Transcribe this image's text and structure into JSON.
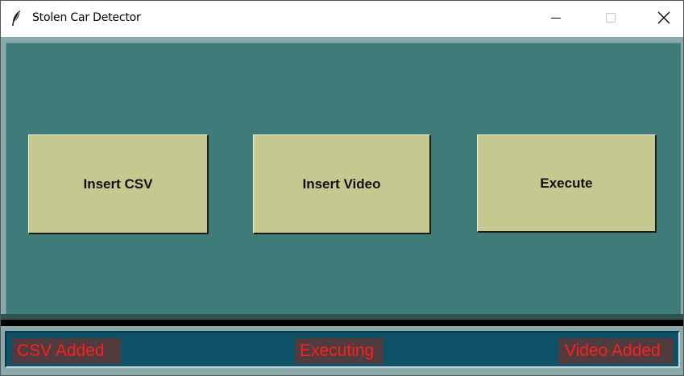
{
  "window": {
    "title": "Stolen Car Detector",
    "icon": "feather-icon",
    "controls": {
      "minimize_icon": "minimize-icon",
      "maximize_icon": "maximize-icon",
      "close_icon": "close-icon"
    }
  },
  "buttons": {
    "insert_csv": "Insert CSV",
    "insert_video": "Insert Video",
    "execute": "Execute"
  },
  "status": {
    "csv": "CSV Added",
    "executing": "Executing",
    "video": "Video Added"
  },
  "colors": {
    "main_background": "#3f7b79",
    "button_face": "#c5c88f",
    "status_bar": "#0e5267",
    "status_label_bg": "#503c3f",
    "status_text": "#ff1e1e"
  }
}
